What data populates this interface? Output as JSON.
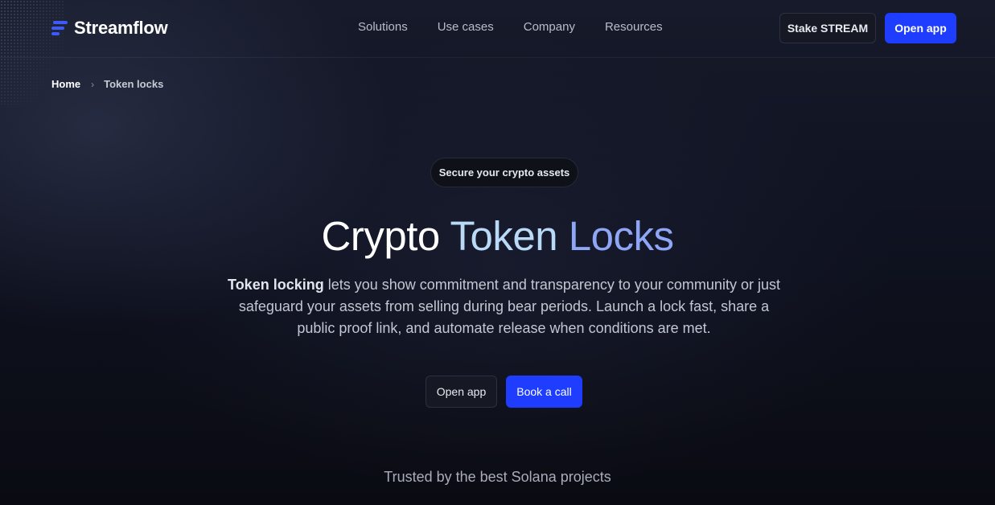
{
  "header": {
    "logo_text": "Streamflow",
    "nav": [
      "Solutions",
      "Use cases",
      "Company",
      "Resources"
    ],
    "stake_label": "Stake STREAM",
    "open_app_label": "Open app",
    "brand_color": "#1e3dff"
  },
  "breadcrumb": {
    "home": "Home",
    "separator_icon": "chevron-right-icon",
    "current": "Token locks"
  },
  "hero": {
    "pill": "Secure your crypto assets",
    "title_parts": [
      "Crypto",
      "Token",
      "Locks"
    ],
    "title_colors": [
      "#ffffff",
      "#b9d9f7",
      "#8fa6f7"
    ],
    "desc_bold": "Token locking",
    "desc_rest": "lets you show commitment and transparency to your community or just safeguard your assets from selling during bear periods. Launch a lock fast, share a public proof link, and automate release when conditions are met.",
    "open_app_label": "Open app",
    "book_call_label": "Book a call"
  },
  "trusted": "Trusted by the best Solana projects"
}
